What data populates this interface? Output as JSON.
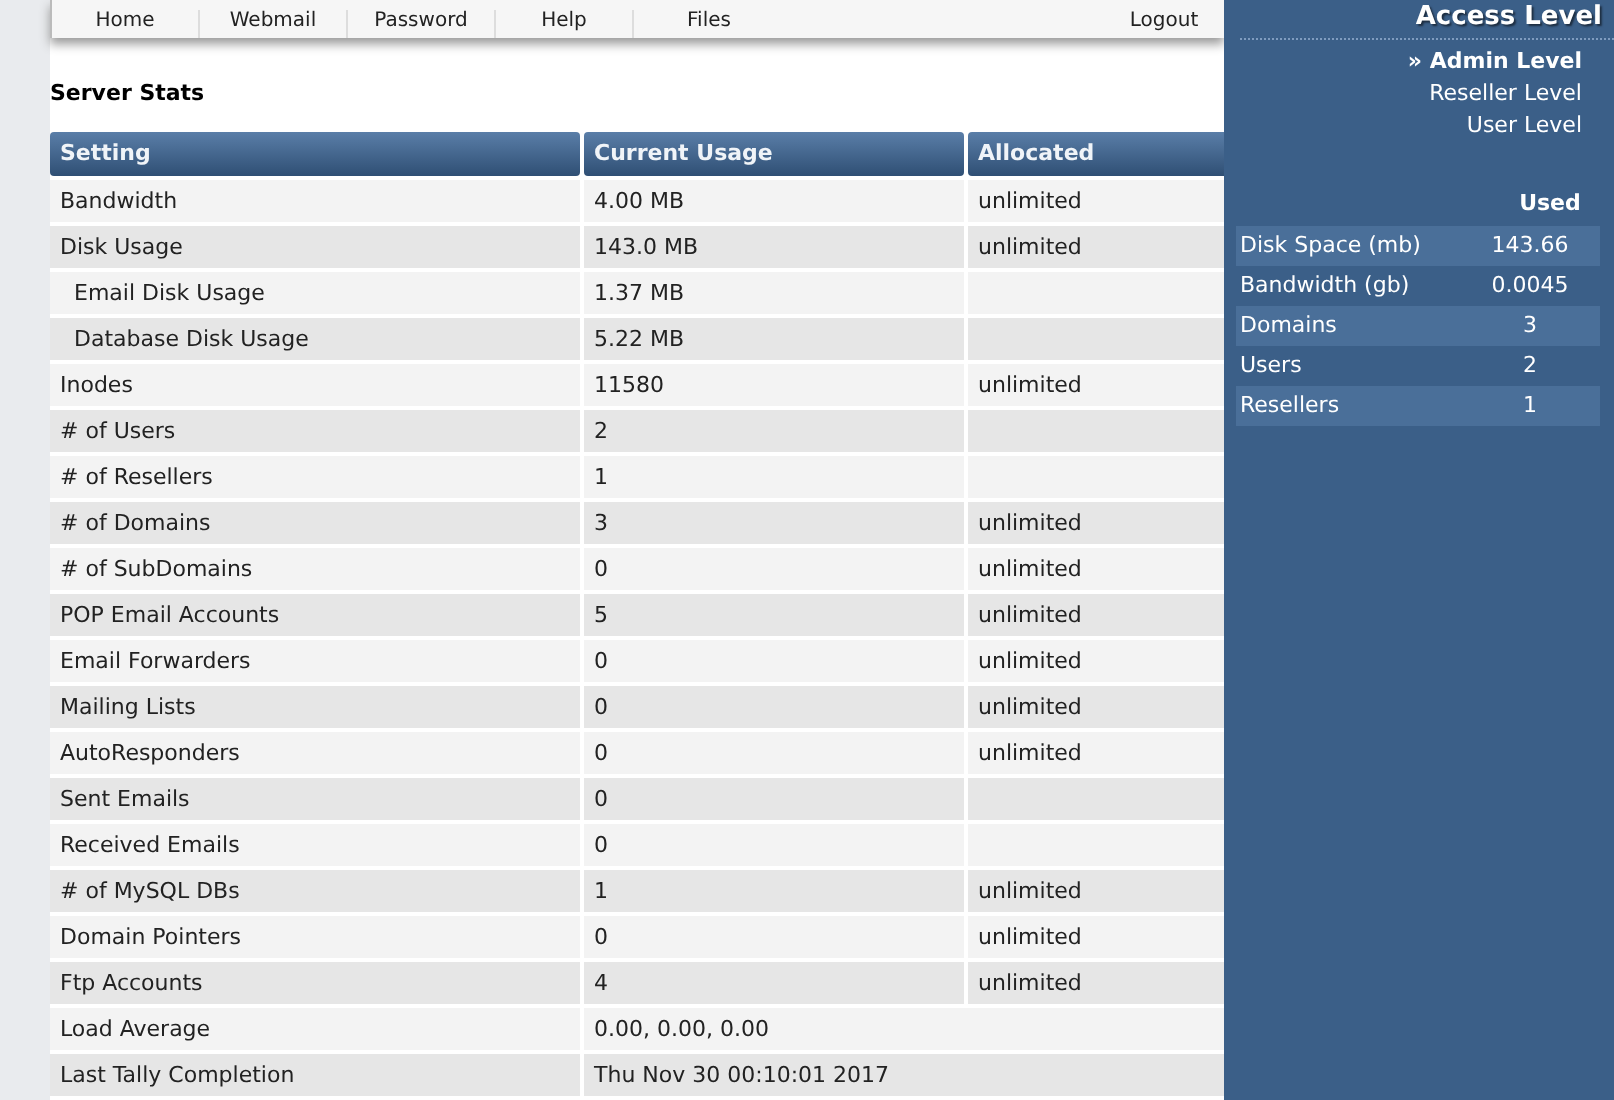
{
  "nav": [
    {
      "label": "Home"
    },
    {
      "label": "Webmail"
    },
    {
      "label": "Password"
    },
    {
      "label": "Help"
    },
    {
      "label": "Files"
    },
    {
      "label": "Logout"
    }
  ],
  "section_title": "Server Stats",
  "table": {
    "columns": [
      "Setting",
      "Current Usage",
      "Allocated"
    ],
    "rows": [
      {
        "setting": "Bandwidth",
        "usage": "4.00 MB",
        "allocated": "unlimited"
      },
      {
        "setting": "Disk Usage",
        "usage": "143.0 MB",
        "allocated": "unlimited",
        "children": [
          {
            "setting": "Email Disk Usage",
            "usage": "1.37 MB"
          },
          {
            "setting": "Database Disk Usage",
            "usage": "5.22 MB"
          }
        ]
      },
      {
        "setting": "Inodes",
        "usage": "11580",
        "allocated": "unlimited"
      },
      {
        "setting": "# of Users",
        "usage": "2"
      },
      {
        "setting": "# of Resellers",
        "usage": "1"
      },
      {
        "setting": "# of Domains",
        "usage": "3",
        "allocated": "unlimited"
      },
      {
        "setting": "# of SubDomains",
        "usage": "0",
        "allocated": "unlimited"
      },
      {
        "setting": "POP Email Accounts",
        "usage": "5",
        "allocated": "unlimited"
      },
      {
        "setting": "Email Forwarders",
        "usage": "0",
        "allocated": "unlimited"
      },
      {
        "setting": "Mailing Lists",
        "usage": "0",
        "allocated": "unlimited"
      },
      {
        "setting": "AutoResponders",
        "usage": "0",
        "allocated": "unlimited"
      },
      {
        "setting": "Sent Emails",
        "usage": "0"
      },
      {
        "setting": "Received Emails",
        "usage": "0"
      },
      {
        "setting": "# of MySQL DBs",
        "usage": "1",
        "allocated": "unlimited"
      },
      {
        "setting": "Domain Pointers",
        "usage": "0",
        "allocated": "unlimited"
      },
      {
        "setting": "Ftp Accounts",
        "usage": "4",
        "allocated": "unlimited"
      },
      {
        "setting": "Load Average",
        "usage": "0.00, 0.00, 0.00",
        "span": true
      },
      {
        "setting": "Last Tally Completion",
        "usage": "Thu Nov 30 00:10:01 2017",
        "span": true
      }
    ]
  },
  "sidebar": {
    "title": "Access Level",
    "marker": "»",
    "levels": [
      {
        "label": "Admin Level",
        "selected": true
      },
      {
        "label": "Reseller Level",
        "selected": false
      },
      {
        "label": "User Level",
        "selected": false
      }
    ],
    "stats_header": "Used",
    "stats": [
      {
        "label": "Disk Space (mb)",
        "value": "143.66"
      },
      {
        "label": "Bandwidth (gb)",
        "value": "0.0045"
      },
      {
        "label": "Domains",
        "value": "3"
      },
      {
        "label": "Users",
        "value": "2"
      },
      {
        "label": "Resellers",
        "value": "1"
      }
    ]
  }
}
